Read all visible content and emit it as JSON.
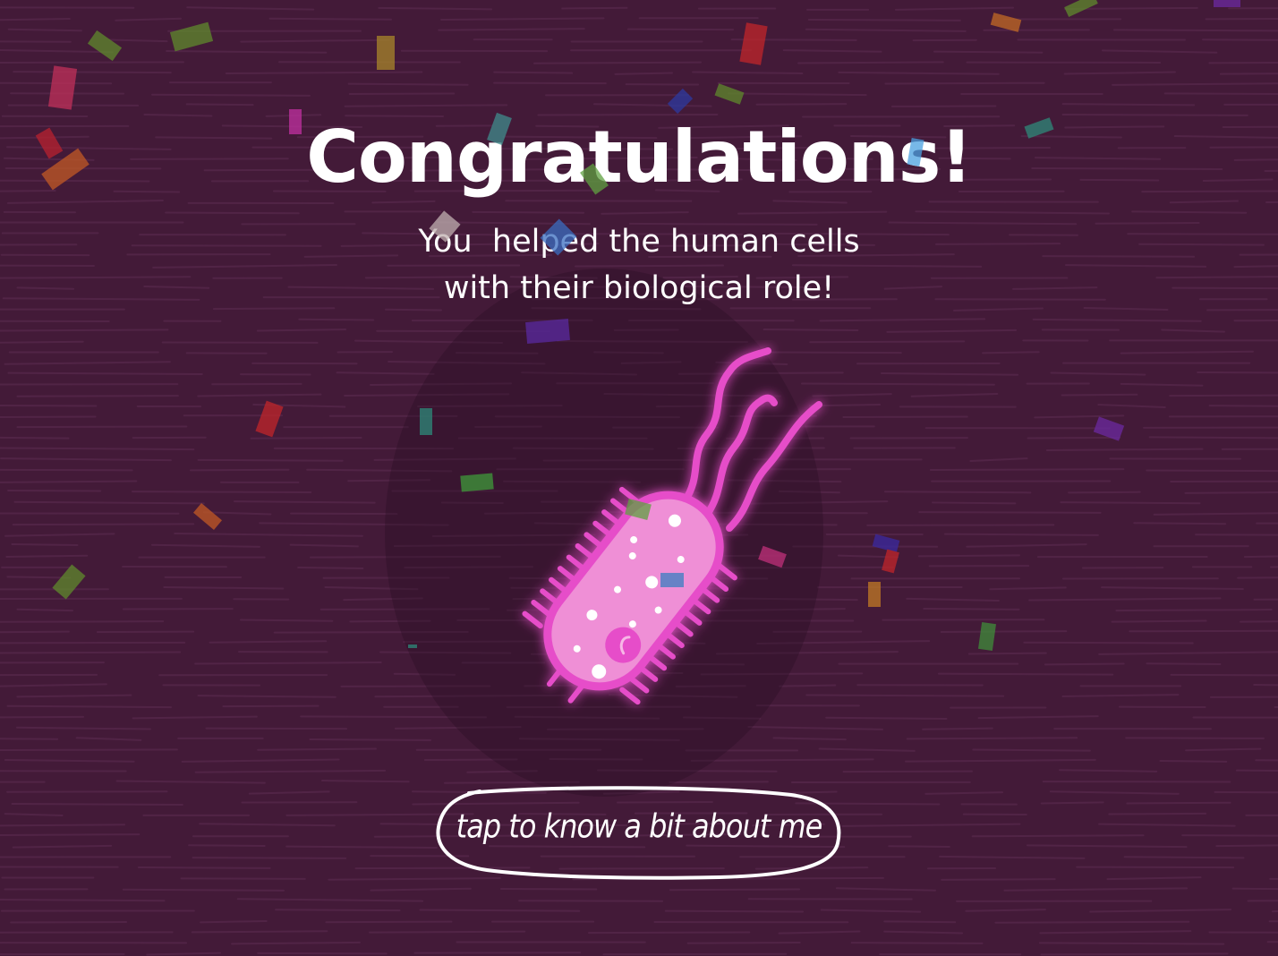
{
  "screen": {
    "title": "Congratulations!",
    "message_lines": [
      "You  helped the human cells",
      "with their biological role!"
    ],
    "cta_label": "tap to know a bit about me"
  },
  "character": {
    "icon": "bacterium-icon"
  },
  "colors": {
    "background": "#431a38",
    "text": "#ffffff",
    "bacterium_body": "#ef8fd6",
    "bacterium_outline": "#e64ec9"
  }
}
